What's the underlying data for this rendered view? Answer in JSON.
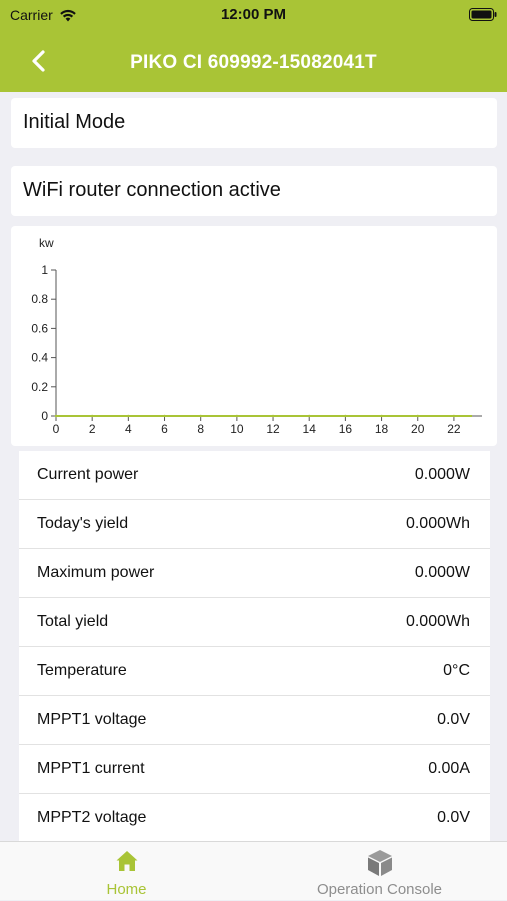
{
  "status_bar": {
    "carrier": "Carrier",
    "time": "12:00 PM"
  },
  "nav": {
    "title": "PIKO CI 609992-15082041T"
  },
  "mode": {
    "text": "Initial Mode"
  },
  "wifi": {
    "text": "WiFi router connection active"
  },
  "chart_data": {
    "type": "line",
    "ylabel": "kw",
    "x_ticks": [
      "0",
      "2",
      "4",
      "6",
      "8",
      "10",
      "12",
      "14",
      "16",
      "18",
      "20",
      "22"
    ],
    "y_ticks": [
      "0",
      "0.2",
      "0.4",
      "0.6",
      "0.8",
      "1"
    ],
    "ylim": [
      0,
      1
    ],
    "xlim": [
      0,
      23
    ],
    "series": [
      {
        "x": [
          0,
          2,
          4,
          6,
          8,
          10,
          12,
          14,
          16,
          18,
          20,
          22
        ],
        "values": [
          0,
          0,
          0,
          0,
          0,
          0,
          0,
          0,
          0,
          0,
          0,
          0
        ]
      }
    ],
    "line_color": "#a9c436",
    "grid": false
  },
  "metrics": [
    {
      "label": "Current power",
      "value": "0.000W"
    },
    {
      "label": "Today's yield",
      "value": "0.000Wh"
    },
    {
      "label": "Maximum power",
      "value": "0.000W"
    },
    {
      "label": "Total yield",
      "value": "0.000Wh"
    },
    {
      "label": "Temperature",
      "value": "0°C"
    },
    {
      "label": "MPPT1 voltage",
      "value": "0.0V"
    },
    {
      "label": "MPPT1 current",
      "value": "0.00A"
    },
    {
      "label": "MPPT2 voltage",
      "value": "0.0V"
    }
  ],
  "tabs": [
    {
      "label": "Home",
      "icon": "home-icon",
      "active": true
    },
    {
      "label": "Operation Console",
      "icon": "cube-icon",
      "active": false
    }
  ],
  "colors": {
    "accent": "#a9c436",
    "background": "#efeff4",
    "inactive_tab": "#8e8e8e"
  }
}
